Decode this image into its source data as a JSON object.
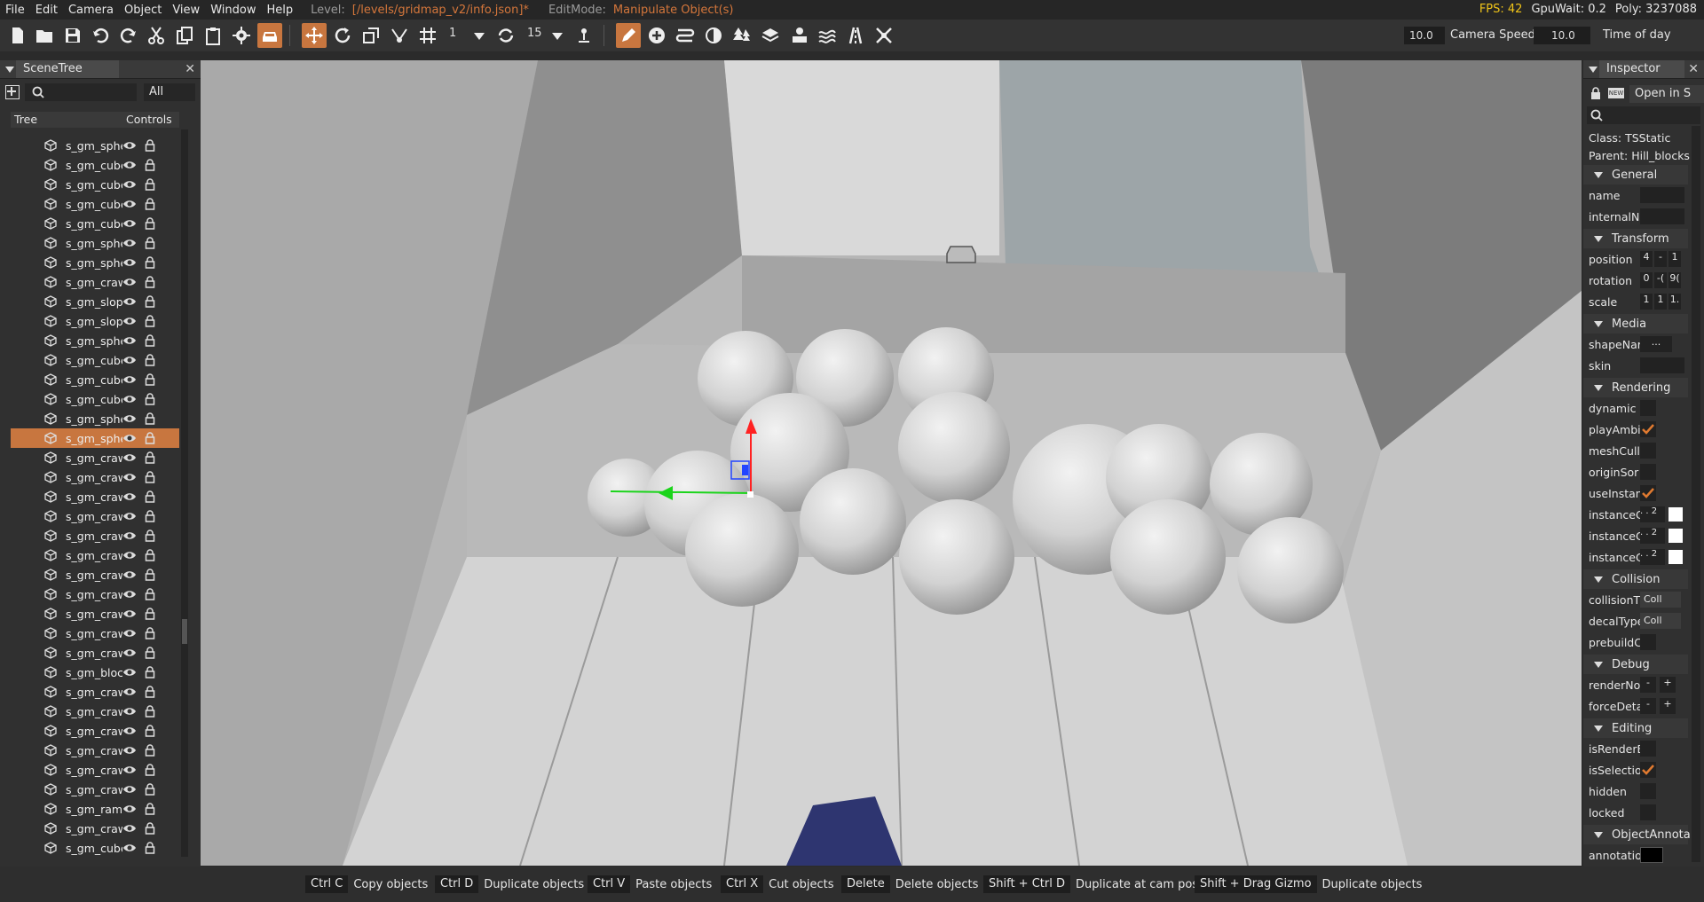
{
  "menu": {
    "items": [
      "File",
      "Edit",
      "Camera",
      "Object",
      "View",
      "Window",
      "Help"
    ],
    "level_label": "Level:",
    "level_value": "[/levels/gridmap_v2/info.json]*",
    "editmode_label": "EditMode:",
    "editmode_value": "Manipulate Object(s)",
    "fps": "FPS: 42",
    "gpuwait": "GpuWait: 0.2",
    "poly": "Poly: 3237088"
  },
  "toolbar": {
    "snap_value": "1",
    "rotate_snap_value": "15",
    "camera_speed_value": "10.0",
    "camera_speed_label": "Camera Speed",
    "time_of_day_value": "10.0",
    "time_of_day_label": "Time of day"
  },
  "scenetree": {
    "title": "SceneTree",
    "filter_value": "All",
    "col_tree": "Tree",
    "col_controls": "Controls",
    "rows": [
      {
        "name": "s_gm_sphe"
      },
      {
        "name": "s_gm_cube"
      },
      {
        "name": "s_gm_cube"
      },
      {
        "name": "s_gm_cube"
      },
      {
        "name": "s_gm_cube"
      },
      {
        "name": "s_gm_sphe"
      },
      {
        "name": "s_gm_sphe"
      },
      {
        "name": "s_gm_craw"
      },
      {
        "name": "s_gm_slop"
      },
      {
        "name": "s_gm_slop"
      },
      {
        "name": "s_gm_sphe"
      },
      {
        "name": "s_gm_cube"
      },
      {
        "name": "s_gm_cube"
      },
      {
        "name": "s_gm_cube"
      },
      {
        "name": "s_gm_sphe"
      },
      {
        "name": "s_gm_sphe",
        "selected": true
      },
      {
        "name": "s_gm_craw"
      },
      {
        "name": "s_gm_craw"
      },
      {
        "name": "s_gm_craw"
      },
      {
        "name": "s_gm_craw"
      },
      {
        "name": "s_gm_craw"
      },
      {
        "name": "s_gm_craw"
      },
      {
        "name": "s_gm_craw"
      },
      {
        "name": "s_gm_craw"
      },
      {
        "name": "s_gm_craw"
      },
      {
        "name": "s_gm_craw"
      },
      {
        "name": "s_gm_craw"
      },
      {
        "name": "s_gm_blocl"
      },
      {
        "name": "s_gm_craw"
      },
      {
        "name": "s_gm_craw"
      },
      {
        "name": "s_gm_craw"
      },
      {
        "name": "s_gm_craw"
      },
      {
        "name": "s_gm_craw"
      },
      {
        "name": "s_gm_craw"
      },
      {
        "name": "s_gm_ramp"
      },
      {
        "name": "s_gm_craw"
      },
      {
        "name": "s_gm_cube"
      }
    ]
  },
  "inspector": {
    "title": "Inspector",
    "open_in": "Open in S",
    "class_line": "Class:  TSStatic",
    "parent_line": "Parent:  Hill_blocks",
    "sections": {
      "general": "General",
      "transform": "Transform",
      "media": "Media",
      "rendering": "Rendering",
      "collision": "Collision",
      "debug": "Debug",
      "editing": "Editing",
      "annotation": "ObjectAnnota"
    },
    "fields": {
      "name": "name",
      "internalName": "internalN",
      "position": "position",
      "rotation": "rotation",
      "scale": "scale",
      "shapeName": "shapeNar",
      "skin": "skin",
      "dynamic": "dynamic",
      "playAmbient": "playAmbi",
      "meshCulling": "meshCulli",
      "originSort": "originSor",
      "useInstance": "useInstan",
      "instanceC1": "instanceC",
      "instanceC2": "instanceC",
      "instanceC3": "instanceC",
      "collisionType": "collisionT",
      "decalType": "decalType",
      "prebuild": "prebuildC",
      "renderNormals": "renderNo",
      "forceDetail": "forceDeta",
      "isRenderEnabled": "isRenderE",
      "isSelectionEnabled": "isSelectio",
      "hidden": "hidden",
      "locked": "locked",
      "annotation": "annotatio"
    },
    "values": {
      "position": [
        "4",
        "-",
        "1"
      ],
      "rotation": [
        "0",
        "-(",
        "9("
      ],
      "scale": [
        "1",
        "1",
        "1."
      ],
      "shape_btn": "...",
      "collision_val": "Coll",
      "decal_val": "Coll",
      "minus": "-",
      "plus": "+",
      "dots": ". . 2"
    }
  },
  "hotkeys": [
    {
      "key": "Ctrl C",
      "desc": "Copy objects"
    },
    {
      "key": "Ctrl D",
      "desc": "Duplicate objects"
    },
    {
      "key": "Ctrl V",
      "desc": "Paste objects"
    },
    {
      "key": "Ctrl X",
      "desc": "Cut objects"
    },
    {
      "key": "Delete",
      "desc": "Delete objects"
    },
    {
      "key": "Shift + Ctrl D",
      "desc": "Duplicate at cam pos"
    },
    {
      "key": "Shift + Drag Gizmo",
      "desc": "Duplicate objects"
    }
  ],
  "colors": {
    "accent": "#c8763f",
    "fps": "#f0c419",
    "bg": "#303030"
  }
}
